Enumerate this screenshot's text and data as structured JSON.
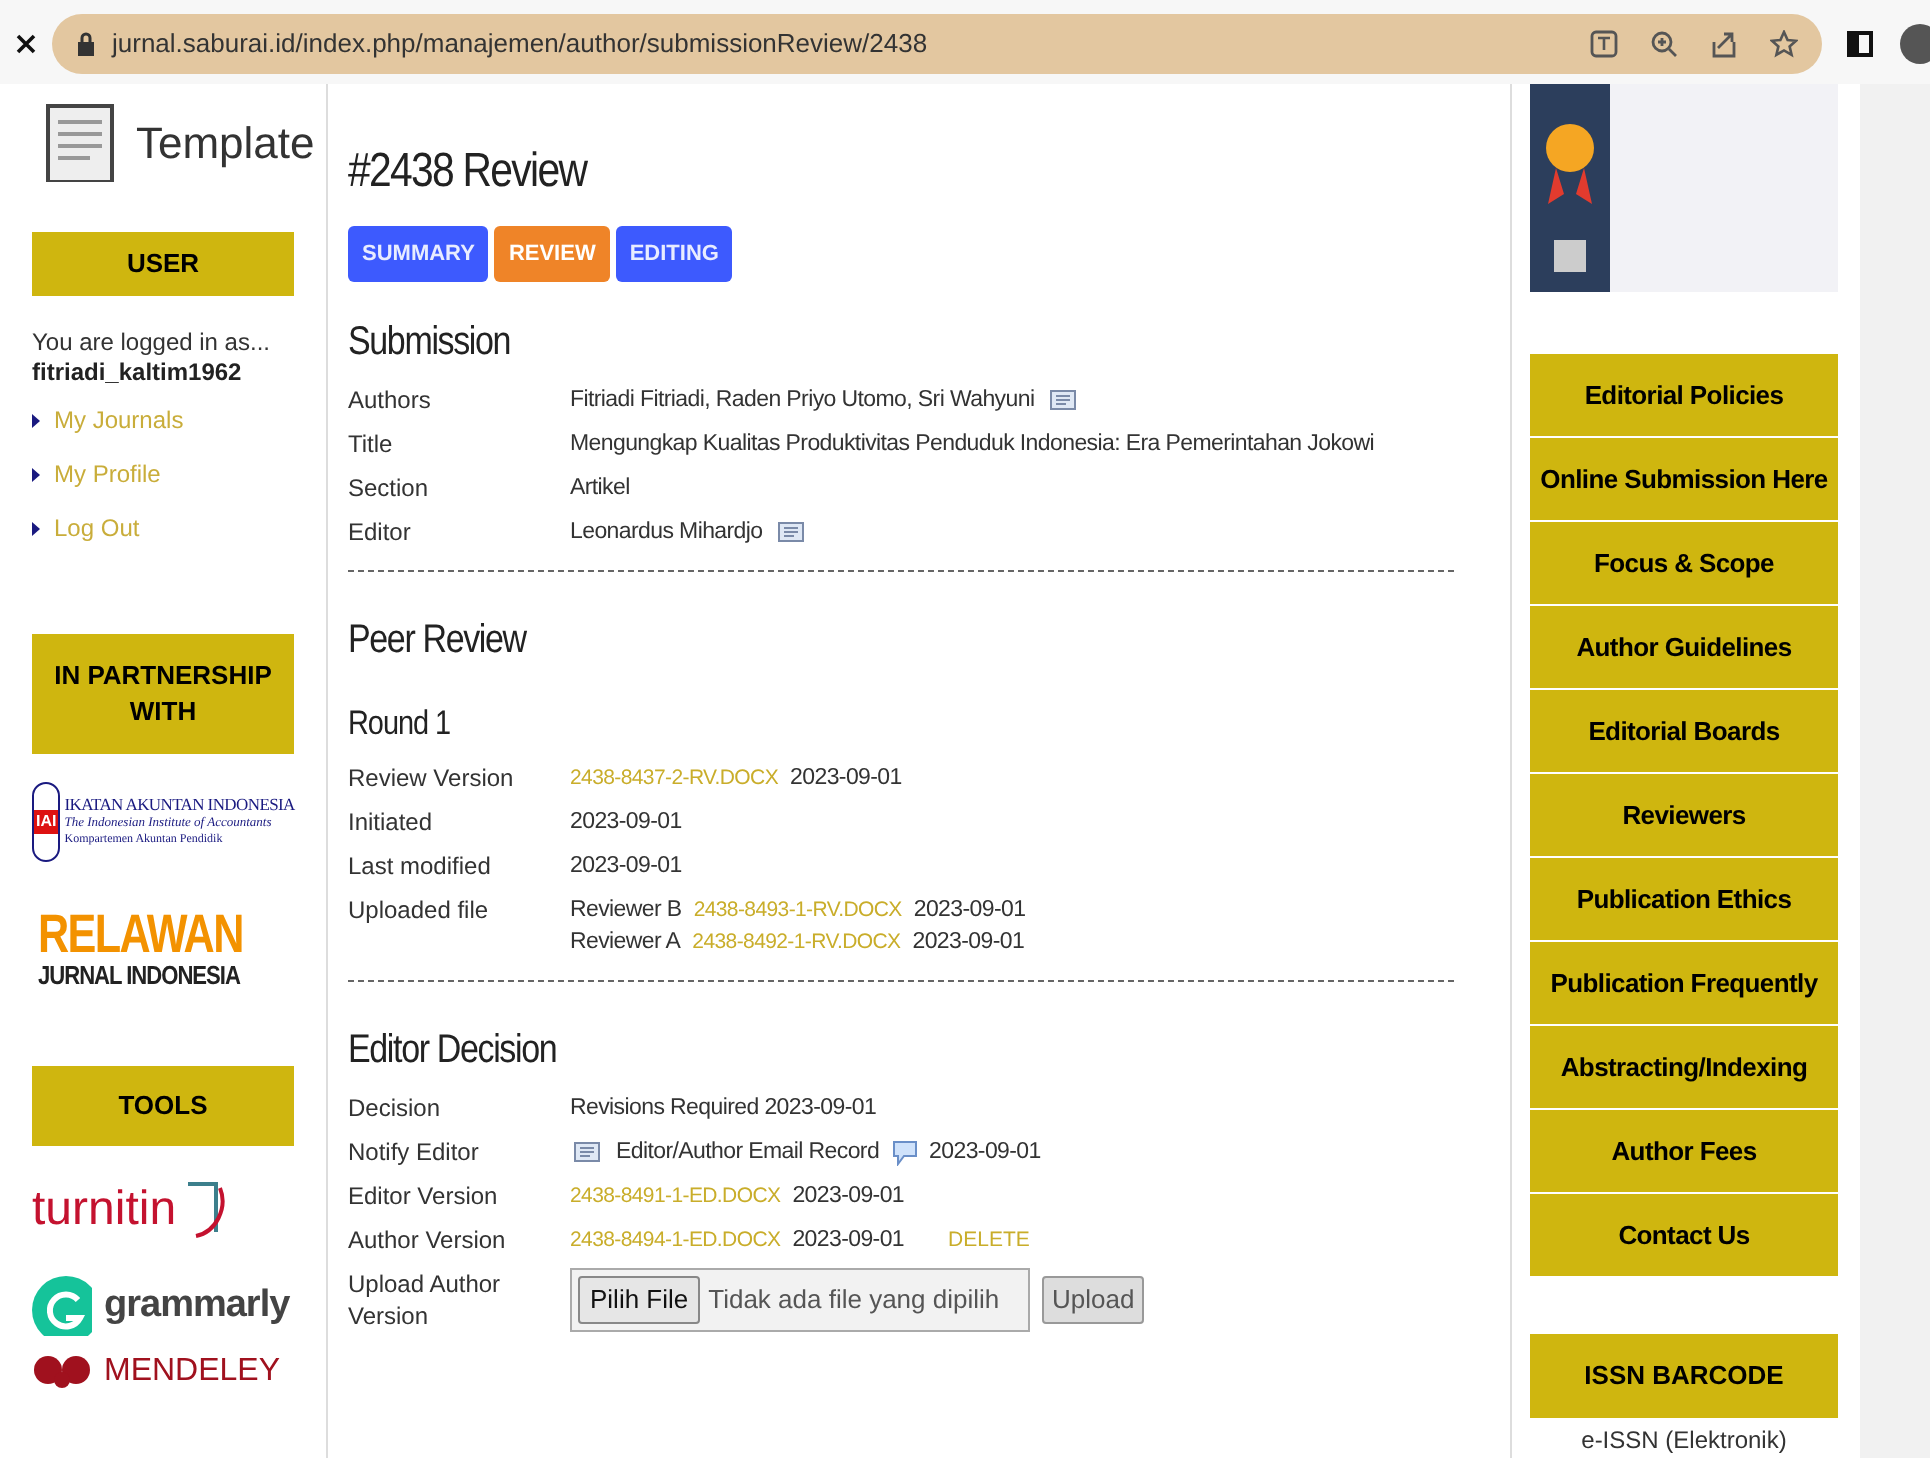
{
  "browser": {
    "url": "jurnal.saburai.id/index.php/manajemen/author/submissionReview/2438"
  },
  "left_sidebar": {
    "template_label": "Template",
    "user_block": {
      "title": "USER",
      "logged_in": "You are logged in as...",
      "username": "fitriadi_kaltim1962",
      "links": [
        "My Journals",
        "My Profile",
        "Log Out"
      ]
    },
    "partnership": {
      "title": "IN PARTNERSHIP WITH",
      "iai_logo": {
        "name": "IKATAN AKUNTAN INDONESIA",
        "subtitle": "The Indonesian Institute of Accountants",
        "department": "Kompartemen Akuntan Pendidik",
        "mark": "IAI"
      },
      "relawan_logo": {
        "top": "RELAWAN",
        "bottom": "JURNAL INDONESIA"
      }
    },
    "tools": {
      "title": "TOOLS",
      "logos": [
        "turnitin",
        "grammarly",
        "MENDELEY"
      ]
    }
  },
  "main": {
    "title": "#2438 Review",
    "tabs": [
      {
        "label": "SUMMARY",
        "selected": false
      },
      {
        "label": "REVIEW",
        "selected": true
      },
      {
        "label": "EDITING",
        "selected": false
      }
    ],
    "sections": [
      {
        "heading": "Submission",
        "rows": [
          {
            "label": "Authors",
            "lines": [
              [
                {
                  "kind": "text",
                  "text": "Fitriadi Fitriadi, Raden Priyo Utomo, Sri Wahyuni"
                },
                {
                  "kind": "mail"
                }
              ]
            ]
          },
          {
            "label": "Title",
            "lines": [
              [
                {
                  "kind": "text",
                  "text": "Mengungkap Kualitas Produktivitas Penduduk Indonesia: Era Pemerintahan Jokowi"
                }
              ]
            ]
          },
          {
            "label": "Section",
            "lines": [
              [
                {
                  "kind": "text",
                  "text": "Artikel"
                }
              ]
            ]
          },
          {
            "label": "Editor",
            "lines": [
              [
                {
                  "kind": "text",
                  "text": "Leonardus Mihardjo"
                },
                {
                  "kind": "mail"
                }
              ]
            ]
          }
        ]
      },
      {
        "heading": "Peer Review",
        "subheading": "Round 1",
        "rows": [
          {
            "label": "Review Version",
            "lines": [
              [
                {
                  "kind": "link",
                  "text": "2438-8437-2-RV.DOCX"
                },
                {
                  "kind": "text",
                  "text": "2023-09-01"
                }
              ]
            ]
          },
          {
            "label": "Initiated",
            "lines": [
              [
                {
                  "kind": "text",
                  "text": "2023-09-01"
                }
              ]
            ]
          },
          {
            "label": "Last modified",
            "lines": [
              [
                {
                  "kind": "text",
                  "text": "2023-09-01"
                }
              ]
            ]
          },
          {
            "label": "Uploaded file",
            "lines": [
              [
                {
                  "kind": "text",
                  "text": "Reviewer B"
                },
                {
                  "kind": "link",
                  "text": "2438-8493-1-RV.DOCX"
                },
                {
                  "kind": "text",
                  "text": "2023-09-01"
                }
              ],
              [
                {
                  "kind": "text",
                  "text": "Reviewer A"
                },
                {
                  "kind": "link",
                  "text": "2438-8492-1-RV.DOCX"
                },
                {
                  "kind": "text",
                  "text": "2023-09-01"
                }
              ]
            ]
          }
        ]
      },
      {
        "heading": "Editor Decision",
        "rows": [
          {
            "label": "Decision",
            "lines": [
              [
                {
                  "kind": "text",
                  "text": "Revisions Required 2023-09-01"
                }
              ]
            ]
          },
          {
            "label": "Notify Editor",
            "lines": [
              [
                {
                  "kind": "mail"
                },
                {
                  "kind": "text",
                  "text": "Editor/Author Email Record"
                },
                {
                  "kind": "comment"
                },
                {
                  "kind": "text",
                  "text": "2023-09-01"
                }
              ]
            ]
          },
          {
            "label": "Editor Version",
            "lines": [
              [
                {
                  "kind": "link",
                  "text": "2438-8491-1-ED.DOCX"
                },
                {
                  "kind": "text",
                  "text": "2023-09-01"
                }
              ]
            ]
          },
          {
            "label": "Author Version",
            "lines": [
              [
                {
                  "kind": "link",
                  "text": "2438-8494-1-ED.DOCX"
                },
                {
                  "kind": "text",
                  "text": "2023-09-01"
                },
                {
                  "kind": "action",
                  "text": "DELETE"
                }
              ]
            ]
          },
          {
            "label": "Upload Author Version",
            "lines": [
              [
                {
                  "kind": "file",
                  "button": "Pilih File",
                  "status": "Tidak ada file yang dipilih"
                },
                {
                  "kind": "button",
                  "text": "Upload"
                }
              ]
            ]
          }
        ]
      }
    ]
  },
  "right_sidebar": {
    "menu": [
      "Editorial Policies",
      "Online Submission Here",
      "Focus & Scope",
      "Author Guidelines",
      "Editorial Boards",
      "Reviewers",
      "Publication Ethics",
      "Publication Frequently",
      "Abstracting/Indexing",
      "Author Fees",
      "Contact Us"
    ],
    "issn": {
      "title": "ISSN BARCODE",
      "caption": "e-ISSN (Elektronik)"
    }
  }
}
